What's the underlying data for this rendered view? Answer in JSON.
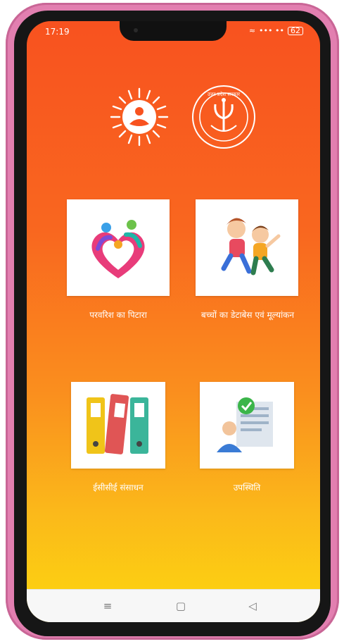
{
  "status_bar": {
    "time": "17:19",
    "signal": "••• ••",
    "battery": "62"
  },
  "logos": [
    {
      "name": "icds-emblem",
      "text": ""
    },
    {
      "name": "up-government-seal",
      "text": "उत्तर प्रदेश सरकार"
    }
  ],
  "menu": [
    {
      "label": "परवरिश का पिटारा"
    },
    {
      "label": "बच्चों का डेटाबेस एवं मूल्यांकन"
    },
    {
      "label": "ईसीसीई संसाधन"
    },
    {
      "label": "उपस्थिति"
    }
  ],
  "navbar": {
    "menu_icon": "≡",
    "home_icon": "▢",
    "back_icon": "◁"
  },
  "colors": {
    "gradient_top": "#f8521f",
    "gradient_bottom": "#fcd70f"
  }
}
